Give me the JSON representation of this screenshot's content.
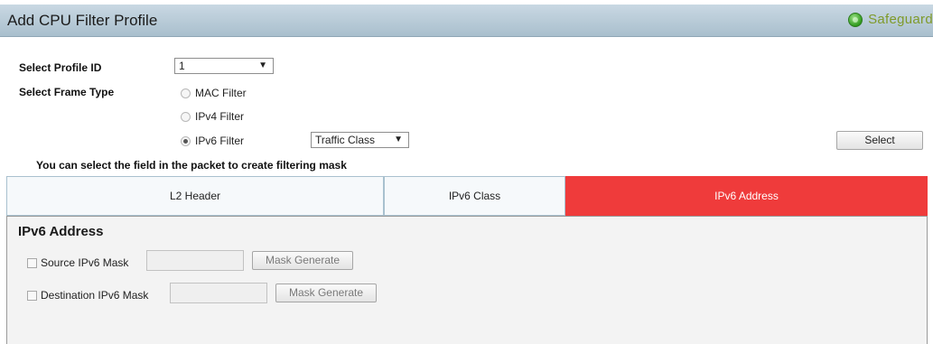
{
  "header": {
    "title": "Add CPU Filter Profile",
    "badge_label": "Safeguard",
    "badge_color": "#7f9a2a"
  },
  "form": {
    "profile_id_label": "Select Profile ID",
    "profile_id_value": "1",
    "frame_type_label": "Select Frame Type",
    "frame_types": [
      {
        "label": "MAC Filter",
        "selected": false
      },
      {
        "label": "IPv4 Filter",
        "selected": false
      },
      {
        "label": "IPv6 Filter",
        "selected": true
      }
    ],
    "ipv6_subtype_value": "Traffic Class",
    "select_button": "Select",
    "hint": "You can select the field in the packet to create filtering mask"
  },
  "tabs": [
    {
      "label": "L2 Header",
      "active": false
    },
    {
      "label": "IPv6 Class",
      "active": false
    },
    {
      "label": "IPv6 Address",
      "active": true
    }
  ],
  "tab_active_color": "#ef3b3b",
  "panel": {
    "title": "IPv6 Address",
    "rows": [
      {
        "label": "Source IPv6 Mask",
        "button": "Mask Generate"
      },
      {
        "label": "Destination IPv6 Mask",
        "button": "Mask Generate"
      }
    ]
  }
}
